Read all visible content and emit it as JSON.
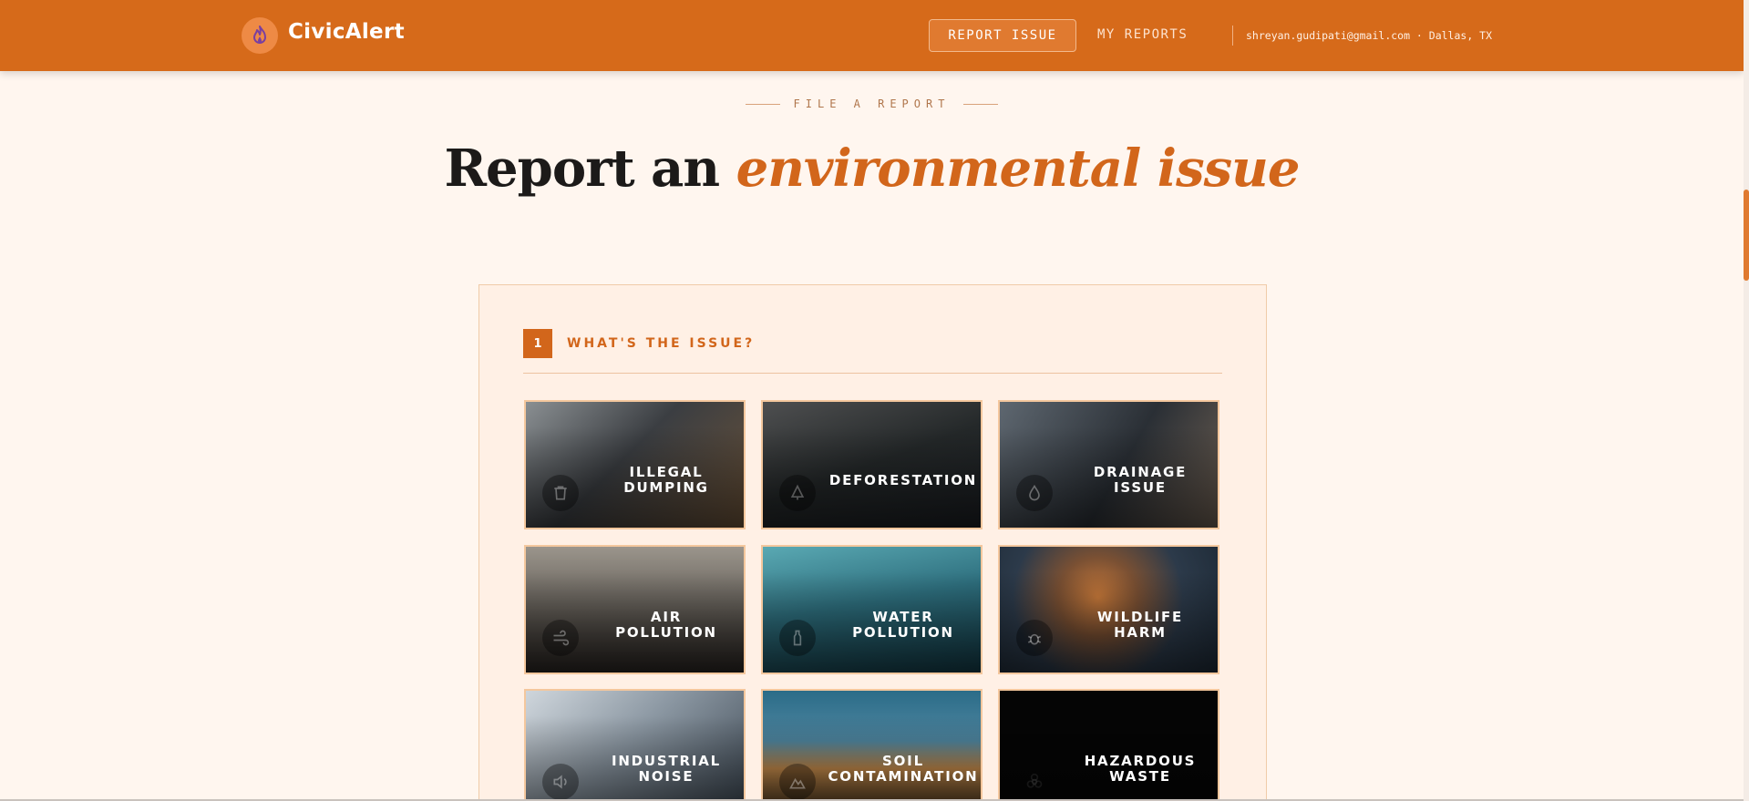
{
  "header": {
    "brand": "CivicAlert",
    "report_issue": "REPORT ISSUE",
    "my_reports": "MY REPORTS",
    "user": "shreyan.gudipati@gmail.com · Dallas, TX"
  },
  "hero": {
    "eyebrow": "FILE A REPORT",
    "title_plain": "Report an ",
    "title_accent": "environmental issue"
  },
  "step": {
    "number": "1",
    "label": "WHAT'S THE ISSUE?"
  },
  "categories": [
    {
      "line1": "ILLEGAL",
      "line2": "DUMPING",
      "icon": "trash-icon"
    },
    {
      "line1": "DEFORESTATION",
      "line2": "",
      "icon": "tree-icon"
    },
    {
      "line1": "DRAINAGE",
      "line2": "ISSUE",
      "icon": "droplet-icon"
    },
    {
      "line1": "AIR",
      "line2": "POLLUTION",
      "icon": "wind-icon"
    },
    {
      "line1": "WATER",
      "line2": "POLLUTION",
      "icon": "bottle-icon"
    },
    {
      "line1": "WILDLIFE",
      "line2": "HARM",
      "icon": "bug-icon"
    },
    {
      "line1": "INDUSTRIAL",
      "line2": "NOISE",
      "icon": "speaker-icon"
    },
    {
      "line1": "SOIL",
      "line2": "CONTAMINATION",
      "icon": "mountain-icon"
    },
    {
      "line1": "HAZARDOUS",
      "line2": "WASTE",
      "icon": "biohazard-icon"
    }
  ],
  "colors": {
    "brand_orange": "#d66a1a",
    "accent_text": "#d2661b",
    "page_bg": "#fff6ef"
  }
}
